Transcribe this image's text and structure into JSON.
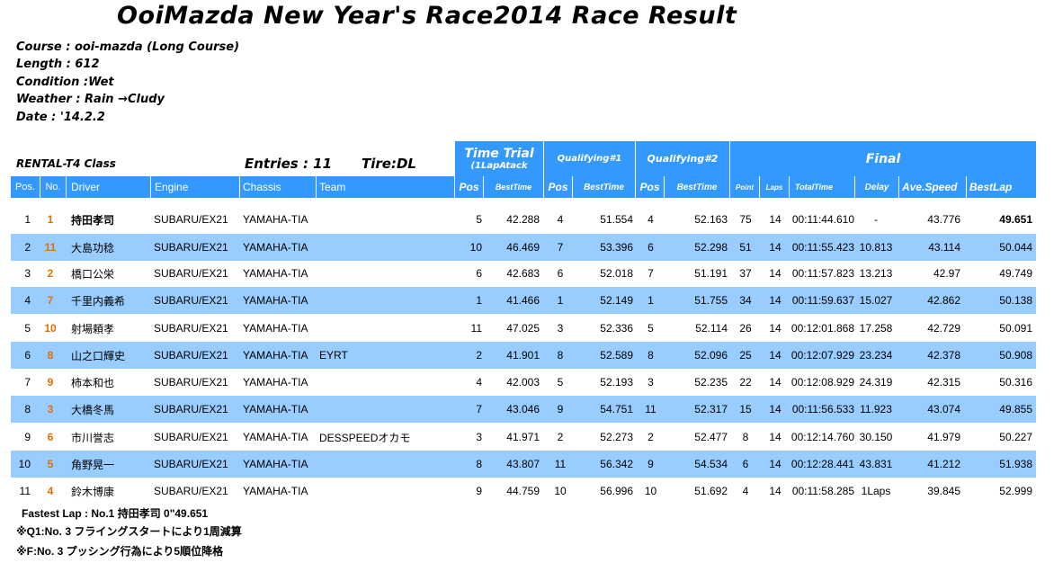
{
  "title": "OoiMazda New Year's Race2014  Race Result",
  "info": {
    "course": "Course : ooi-mazda (Long Course)",
    "length": "Length : 612",
    "condition": "Condition :Wet",
    "weather": "Weather : Rain →Cludy",
    "date": "Date : '14.2.2"
  },
  "class_label": "RENTAL-T4 Class",
  "entries": "Entries : 11",
  "tire": "Tire:DL",
  "groups": {
    "time_trial": "Time Trial",
    "time_trial_sub": "(1LapAtack",
    "q1": "Qualifying#1",
    "q2": "Qualifying#2",
    "final": "Final"
  },
  "columns": {
    "pos": "Pos.",
    "no": "No.",
    "driver": "Driver",
    "engine": "Engine",
    "chassis": "Chassis",
    "team": "Team",
    "tt_pos": "Pos",
    "tt_best": "BestTime",
    "q1_pos": "Pos",
    "q1_best": "BestTime",
    "q2_pos": "Pos",
    "q2_best": "BestTime",
    "point": "Point",
    "laps": "Laps",
    "total": "TotalTime",
    "delay": "Delay",
    "speed": "Ave.Speed",
    "bestlap": "BestLap"
  },
  "rows": [
    {
      "pos": "1",
      "no": "1",
      "driver": "持田孝司",
      "engine": "SUBARU/EX21",
      "chassis": "YAMAHA-TIA",
      "team": "",
      "tt_pos": "5",
      "tt_best": "42.288",
      "q1_pos": "4",
      "q1_best": "51.554",
      "q2_pos": "4",
      "q2_best": "52.163",
      "point": "75",
      "laps": "14",
      "total": "00:11:44.610",
      "delay": "-",
      "speed": "43.776",
      "bestlap": "49.651"
    },
    {
      "pos": "2",
      "no": "11",
      "driver": "大島功稔",
      "engine": "SUBARU/EX21",
      "chassis": "YAMAHA-TIA",
      "team": "",
      "tt_pos": "10",
      "tt_best": "46.469",
      "q1_pos": "7",
      "q1_best": "53.396",
      "q2_pos": "6",
      "q2_best": "52.298",
      "point": "51",
      "laps": "14",
      "total": "00:11:55.423",
      "delay": "10.813",
      "speed": "43.114",
      "bestlap": "50.044"
    },
    {
      "pos": "3",
      "no": "2",
      "driver": "橋口公栄",
      "engine": "SUBARU/EX21",
      "chassis": "YAMAHA-TIA",
      "team": "",
      "tt_pos": "6",
      "tt_best": "42.683",
      "q1_pos": "6",
      "q1_best": "52.018",
      "q2_pos": "7",
      "q2_best": "51.191",
      "point": "37",
      "laps": "14",
      "total": "00:11:57.823",
      "delay": "13.213",
      "speed": "42.97",
      "bestlap": "49.749"
    },
    {
      "pos": "4",
      "no": "7",
      "driver": "千里内義希",
      "engine": "SUBARU/EX21",
      "chassis": "YAMAHA-TIA",
      "team": "",
      "tt_pos": "1",
      "tt_best": "41.466",
      "q1_pos": "1",
      "q1_best": "52.149",
      "q2_pos": "1",
      "q2_best": "51.755",
      "point": "34",
      "laps": "14",
      "total": "00:11:59.637",
      "delay": "15.027",
      "speed": "42.862",
      "bestlap": "50.138"
    },
    {
      "pos": "5",
      "no": "10",
      "driver": "射場頼孝",
      "engine": "SUBARU/EX21",
      "chassis": "YAMAHA-TIA",
      "team": "",
      "tt_pos": "11",
      "tt_best": "47.025",
      "q1_pos": "3",
      "q1_best": "52.336",
      "q2_pos": "5",
      "q2_best": "52.114",
      "point": "26",
      "laps": "14",
      "total": "00:12:01.868",
      "delay": "17.258",
      "speed": "42.729",
      "bestlap": "50.091"
    },
    {
      "pos": "6",
      "no": "8",
      "driver": "山之口輝史",
      "engine": "SUBARU/EX21",
      "chassis": "YAMAHA-TIA",
      "team": "EYRT",
      "tt_pos": "2",
      "tt_best": "41.901",
      "q1_pos": "8",
      "q1_best": "52.589",
      "q2_pos": "8",
      "q2_best": "52.096",
      "point": "25",
      "laps": "14",
      "total": "00:12:07.929",
      "delay": "23.234",
      "speed": "42.378",
      "bestlap": "50.908"
    },
    {
      "pos": "7",
      "no": "9",
      "driver": "柿本和也",
      "engine": "SUBARU/EX21",
      "chassis": "YAMAHA-TIA",
      "team": "",
      "tt_pos": "4",
      "tt_best": "42.003",
      "q1_pos": "5",
      "q1_best": "52.193",
      "q2_pos": "3",
      "q2_best": "52.235",
      "point": "22",
      "laps": "14",
      "total": "00:12:08.929",
      "delay": "24.319",
      "speed": "42.315",
      "bestlap": "50.316"
    },
    {
      "pos": "8",
      "no": "3",
      "driver": "大橋冬馬",
      "engine": "SUBARU/EX21",
      "chassis": "YAMAHA-TIA",
      "team": "",
      "tt_pos": "7",
      "tt_best": "43.046",
      "q1_pos": "9",
      "q1_best": "54.751",
      "q2_pos": "11",
      "q2_best": "52.317",
      "point": "15",
      "laps": "14",
      "total": "00:11:56.533",
      "delay": "11.923",
      "speed": "43.074",
      "bestlap": "49.855"
    },
    {
      "pos": "9",
      "no": "6",
      "driver": "市川誉志",
      "engine": "SUBARU/EX21",
      "chassis": "YAMAHA-TIA",
      "team": "DESSPEEDオカモ",
      "tt_pos": "3",
      "tt_best": "41.971",
      "q1_pos": "2",
      "q1_best": "52.273",
      "q2_pos": "2",
      "q2_best": "52.477",
      "point": "8",
      "laps": "14",
      "total": "00:12:14.760",
      "delay": "30.150",
      "speed": "41.979",
      "bestlap": "50.227"
    },
    {
      "pos": "10",
      "no": "5",
      "driver": "角野晃一",
      "engine": "SUBARU/EX21",
      "chassis": "YAMAHA-TIA",
      "team": "",
      "tt_pos": "8",
      "tt_best": "43.807",
      "q1_pos": "11",
      "q1_best": "56.342",
      "q2_pos": "9",
      "q2_best": "54.534",
      "point": "6",
      "laps": "14",
      "total": "00:12:28.441",
      "delay": "43.831",
      "speed": "41.212",
      "bestlap": "51.938"
    },
    {
      "pos": "11",
      "no": "4",
      "driver": "鈴木博康",
      "engine": "SUBARU/EX21",
      "chassis": "YAMAHA-TIA",
      "team": "",
      "tt_pos": "9",
      "tt_best": "44.759",
      "q1_pos": "10",
      "q1_best": "56.996",
      "q2_pos": "10",
      "q2_best": "51.692",
      "point": "4",
      "laps": "14",
      "total": "00:11:58.285",
      "delay": "1Laps",
      "speed": "39.845",
      "bestlap": "52.999"
    }
  ],
  "notes": {
    "fastest": "Fastest Lap : No.1  持田孝司    0\"49.651",
    "q1": "※Q1:No. 3  フライングスタートにより1周減算",
    "f": "※F:No. 3  プッシング行為により5順位降格"
  }
}
